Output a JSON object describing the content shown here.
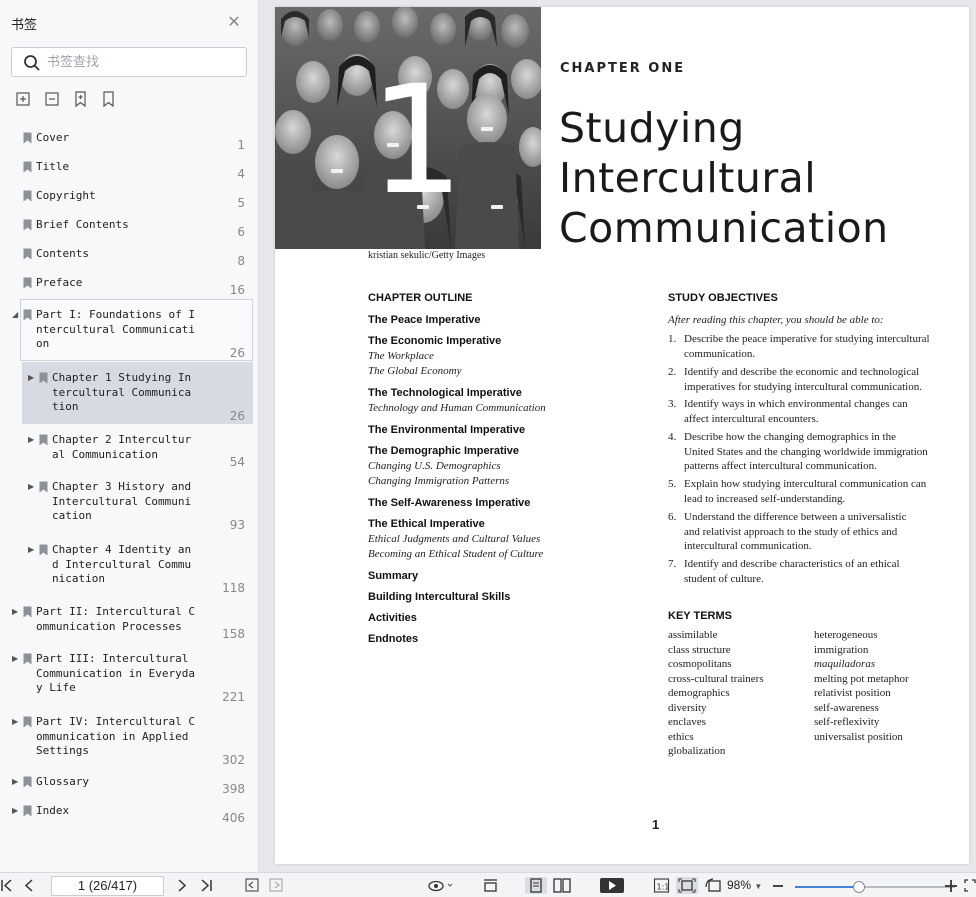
{
  "sidebar": {
    "title": "书签",
    "search_placeholder": "书签查找",
    "bookmarks": [
      {
        "label": "Cover",
        "page": "1"
      },
      {
        "label": "Title",
        "page": "4"
      },
      {
        "label": "Copyright",
        "page": "5"
      },
      {
        "label": "Brief Contents",
        "page": "6"
      },
      {
        "label": "Contents",
        "page": "8"
      },
      {
        "label": "Preface",
        "page": "16"
      },
      {
        "label": "Part I: Foundations of I\nntercultural Communicati\non",
        "page": "26"
      },
      {
        "label": "Chapter 1 Studying In\ntercultural Communica\ntion",
        "page": "26"
      },
      {
        "label": "Chapter 2 Intercultur\nal Communication",
        "page": "54"
      },
      {
        "label": "Chapter 3 History and\nIntercultural Communi\ncation",
        "page": "93"
      },
      {
        "label": "Chapter 4 Identity an\nd Intercultural Commu\nnication",
        "page": "118"
      },
      {
        "label": "Part II: Intercultural C\nommunication Processes",
        "page": "158"
      },
      {
        "label": "Part III: Intercultural\nCommunication in Everyda\ny Life",
        "page": "221"
      },
      {
        "label": "Part IV: Intercultural C\nommunication in Applied\nSettings",
        "page": "302"
      },
      {
        "label": "Glossary",
        "page": "398"
      },
      {
        "label": "Index",
        "page": "406"
      }
    ]
  },
  "page": {
    "photo_credit": "kristian sekulic/Getty Images",
    "photo_numeral": "1",
    "chapter_label": "CHAPTER ONE",
    "chapter_title_lines": [
      "Studying",
      "Intercultural",
      "Communication"
    ],
    "outline_heading": "CHAPTER OUTLINE",
    "outline": [
      {
        "text": "The Peace Imperative",
        "kind": "item"
      },
      {
        "text": "The Economic Imperative",
        "kind": "item"
      },
      {
        "text": "The Workplace",
        "kind": "sub"
      },
      {
        "text": "The Global Economy",
        "kind": "sub"
      },
      {
        "text": "The Technological Imperative",
        "kind": "item"
      },
      {
        "text": "Technology and Human Communication",
        "kind": "sub"
      },
      {
        "text": "The Environmental Imperative",
        "kind": "item"
      },
      {
        "text": "The Demographic Imperative",
        "kind": "item"
      },
      {
        "text": "Changing U.S. Demographics",
        "kind": "sub"
      },
      {
        "text": "Changing Immigration Patterns",
        "kind": "sub"
      },
      {
        "text": "The Self-Awareness Imperative",
        "kind": "item"
      },
      {
        "text": "The Ethical Imperative",
        "kind": "item"
      },
      {
        "text": "Ethical Judgments and Cultural Values",
        "kind": "sub"
      },
      {
        "text": "Becoming an Ethical Student of Culture",
        "kind": "sub"
      },
      {
        "text": "Summary",
        "kind": "item"
      },
      {
        "text": "Building Intercultural Skills",
        "kind": "item"
      },
      {
        "text": "Activities",
        "kind": "item"
      },
      {
        "text": "Endnotes",
        "kind": "item"
      }
    ],
    "objectives_heading": "STUDY OBJECTIVES",
    "objectives_intro": "After reading this chapter, you should be able to:",
    "objectives": [
      {
        "n": "1.",
        "lines": [
          "Describe the peace imperative for studying intercultural",
          "communication."
        ]
      },
      {
        "n": "2.",
        "lines": [
          "Identify and describe the economic and technological",
          "imperatives for studying intercultural communication."
        ]
      },
      {
        "n": "3.",
        "lines": [
          "Identify ways in which environmental changes can",
          "affect intercultural encounters."
        ]
      },
      {
        "n": "4.",
        "lines": [
          "Describe how the changing demographics in the",
          "United States and the changing worldwide immigration",
          "patterns affect intercultural communication."
        ]
      },
      {
        "n": "5.",
        "lines": [
          "Explain how studying intercultural communication can",
          "lead to increased self-understanding."
        ]
      },
      {
        "n": "6.",
        "lines": [
          "Understand the difference between a universalistic",
          "and relativist approach to the study of ethics and",
          "intercultural communication."
        ]
      },
      {
        "n": "7.",
        "lines": [
          "Identify and describe characteristics of an ethical",
          "student of culture."
        ]
      }
    ],
    "key_terms_heading": "KEY TERMS",
    "key_terms_left": [
      "assimilable",
      "class structure",
      "cosmopolitans",
      "cross-cultural trainers",
      "demographics",
      "diversity",
      "enclaves",
      "ethics",
      "globalization"
    ],
    "key_terms_right": [
      "heterogeneous",
      "immigration",
      "maquiladoras",
      "melting pot metaphor",
      "relativist position",
      "self-awareness",
      "self-reflexivity",
      "universalist position"
    ],
    "key_terms_right_italic_index": 2,
    "page_number": "1"
  },
  "toolbar": {
    "page_indicator": "1 (26/417)",
    "zoom": "98%",
    "zoom_level": 0.4
  }
}
